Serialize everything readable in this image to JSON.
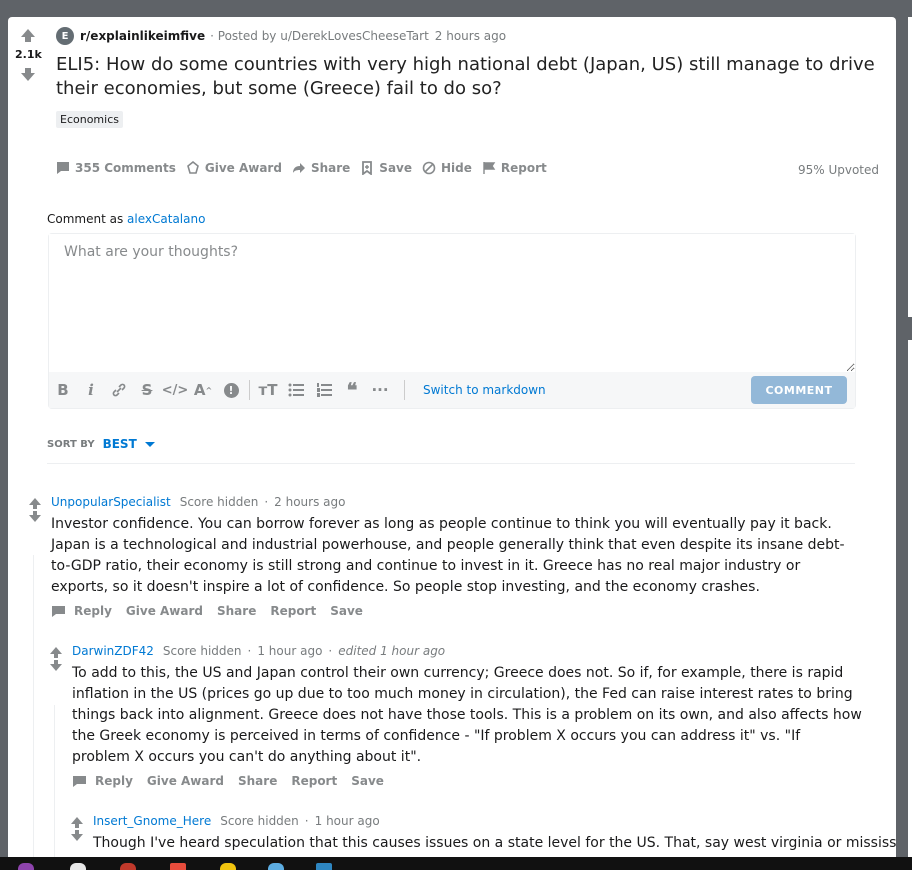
{
  "post": {
    "score": "2.1k",
    "subreddit_icon_letter": "E",
    "subreddit": "r/explainlikeimfive",
    "posted_by": "· Posted by u/DerekLovesCheeseTart",
    "time": "2 hours ago",
    "title": "ELI5: How do some countries with very high national debt (Japan, US) still manage to drive their economies, but some (Greece) fail to do so?",
    "flair": "Economics",
    "actions": {
      "comments": "355 Comments",
      "award": "Give Award",
      "share": "Share",
      "save": "Save",
      "hide": "Hide",
      "report": "Report"
    },
    "upvoted": "95% Upvoted"
  },
  "composer": {
    "comment_as_label": "Comment as",
    "username": "alexCatalano",
    "placeholder": "What are your thoughts?",
    "switch_markdown": "Switch to markdown",
    "submit": "COMMENT"
  },
  "sort": {
    "label": "SORT BY",
    "value": "BEST"
  },
  "comments": [
    {
      "author": "UnpopularSpecialist",
      "score": "Score hidden",
      "time": "2 hours ago",
      "edited": "",
      "body": "Investor confidence. You can borrow forever as long as people continue to think you will eventually pay it back. Japan is a technological and industrial powerhouse, and people generally think that even despite its insane debt-to-GDP ratio, their economy is still strong and continue to invest in it. Greece has no real major industry or exports, so it doesn't inspire a lot of confidence. So people stop investing, and the economy crashes.",
      "reply": "Reply",
      "award": "Give Award",
      "share": "Share",
      "report": "Report",
      "save": "Save"
    },
    {
      "author": "DarwinZDF42",
      "score": "Score hidden",
      "time": "1 hour ago",
      "edited": "edited 1 hour ago",
      "body": "To add to this, the US and Japan control their own currency; Greece does not. So if, for example, there is rapid inflation in the US (prices go up due to too much money in circulation), the Fed can raise interest rates to bring things back into alignment. Greece does not have those tools. This is a problem on its own, and also affects how the Greek economy is perceived in terms of confidence - \"If problem X occurs you can address it\" vs. \"If problem X occurs you can't do anything about it\".",
      "reply": "Reply",
      "award": "Give Award",
      "share": "Share",
      "report": "Report",
      "save": "Save"
    },
    {
      "author": "Insert_Gnome_Here",
      "score": "Score hidden",
      "time": "1 hour ago",
      "edited": "",
      "body": "Though I've heard speculation that this causes issues on a state level for the US. That, say west virginia or mississippi"
    }
  ],
  "colors": {
    "accent": "#0079d3",
    "muted": "#878a8c",
    "button_disabled": "#93b8d8"
  }
}
